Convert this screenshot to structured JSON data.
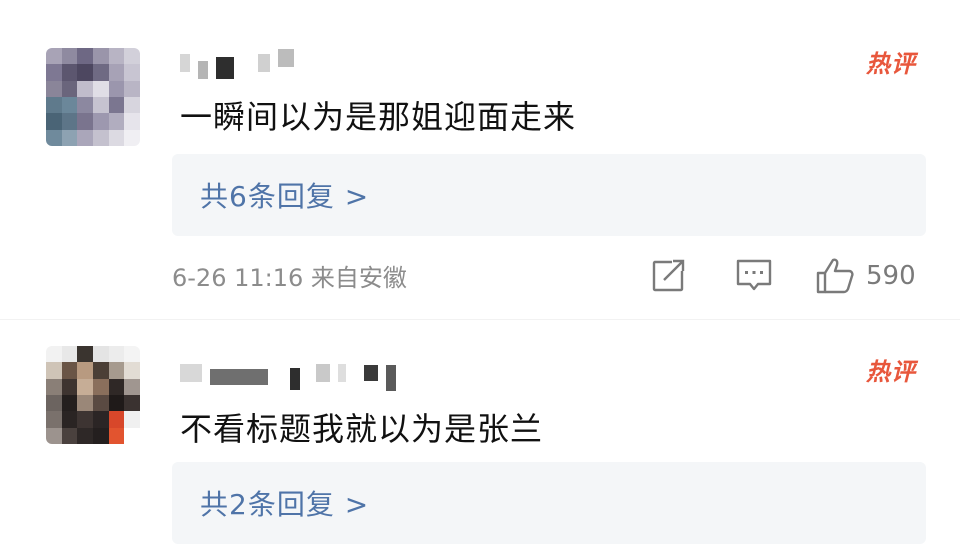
{
  "comments": [
    {
      "hot_badge": "热评",
      "text": "一瞬间以为是那姐迎面走来",
      "replies_label": "共6条回复 >",
      "meta": "6-26 11:16 来自安徽",
      "like_count": "590"
    },
    {
      "hot_badge": "热评",
      "text": "不看标题我就以为是张兰",
      "replies_label": "共2条回复 >"
    }
  ],
  "colors": {
    "hot_badge": "#e8573c",
    "reply_link": "#4f74a8",
    "reply_bg": "#f4f6f8",
    "meta": "#8c8c8c"
  },
  "icons": [
    "share-icon",
    "comment-icon",
    "thumbs-up-icon"
  ]
}
